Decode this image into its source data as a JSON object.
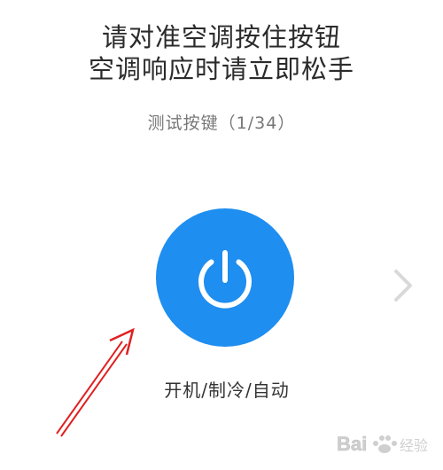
{
  "instruction": {
    "line1": "请对准空调按住按钮",
    "line2": "空调响应时请立即松手"
  },
  "progress": {
    "label": "测试按键（1/34）",
    "current": 1,
    "total": 34
  },
  "power_button": {
    "icon": "power-icon",
    "color": "#1e8ef0",
    "label": "开机/制冷/自动"
  },
  "next_button": {
    "icon": "chevron-right-icon"
  },
  "annotation": {
    "arrow_color": "#e02020"
  },
  "watermark": {
    "text": "Bai 经验"
  }
}
